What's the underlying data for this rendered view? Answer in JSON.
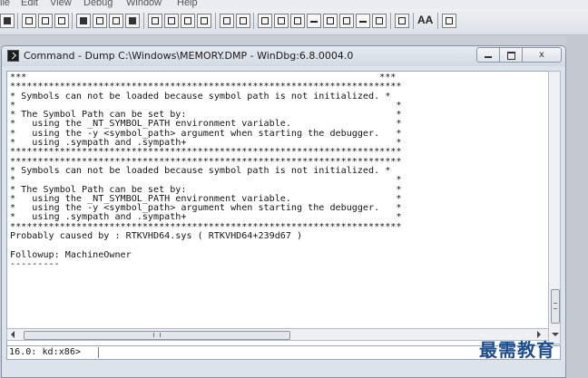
{
  "menu": {
    "items": [
      "ile",
      "Edit",
      "View",
      "Debug",
      "Window",
      "Help"
    ]
  },
  "toolbar": {
    "font_button_label": "AA"
  },
  "window": {
    "title": "Command - Dump C:\\Windows\\MEMORY.DMP - WinDbg:6.8.0004.0",
    "controls": {
      "minimize": "minimize",
      "restore": "restore",
      "close": "x"
    }
  },
  "output": {
    "lines": [
      "***                                                                ***",
      "***********************************************************************",
      "* Symbols can not be loaded because symbol path is not initialized. *",
      "*                                                                     *",
      "* The Symbol Path can be set by:                                      *",
      "*   using the _NT_SYMBOL_PATH environment variable.                   *",
      "*   using the -y <symbol_path> argument when starting the debugger.   *",
      "*   using .sympath and .sympath+                                      *",
      "***********************************************************************",
      "***********************************************************************",
      "* Symbols can not be loaded because symbol path is not initialized. *",
      "*                                                                     *",
      "* The Symbol Path can be set by:                                      *",
      "*   using the _NT_SYMBOL_PATH environment variable.                   *",
      "*   using the -y <symbol_path> argument when starting the debugger.   *",
      "*   using .sympath and .sympath+                                      *",
      "***********************************************************************",
      "Probably caused by : RTKVHD64.sys ( RTKVHD64+239d67 )",
      "",
      "Followup: MachineOwner",
      "---------"
    ]
  },
  "command": {
    "prompt": "16.0: kd:x86>",
    "value": ""
  },
  "watermark": "最需教育"
}
